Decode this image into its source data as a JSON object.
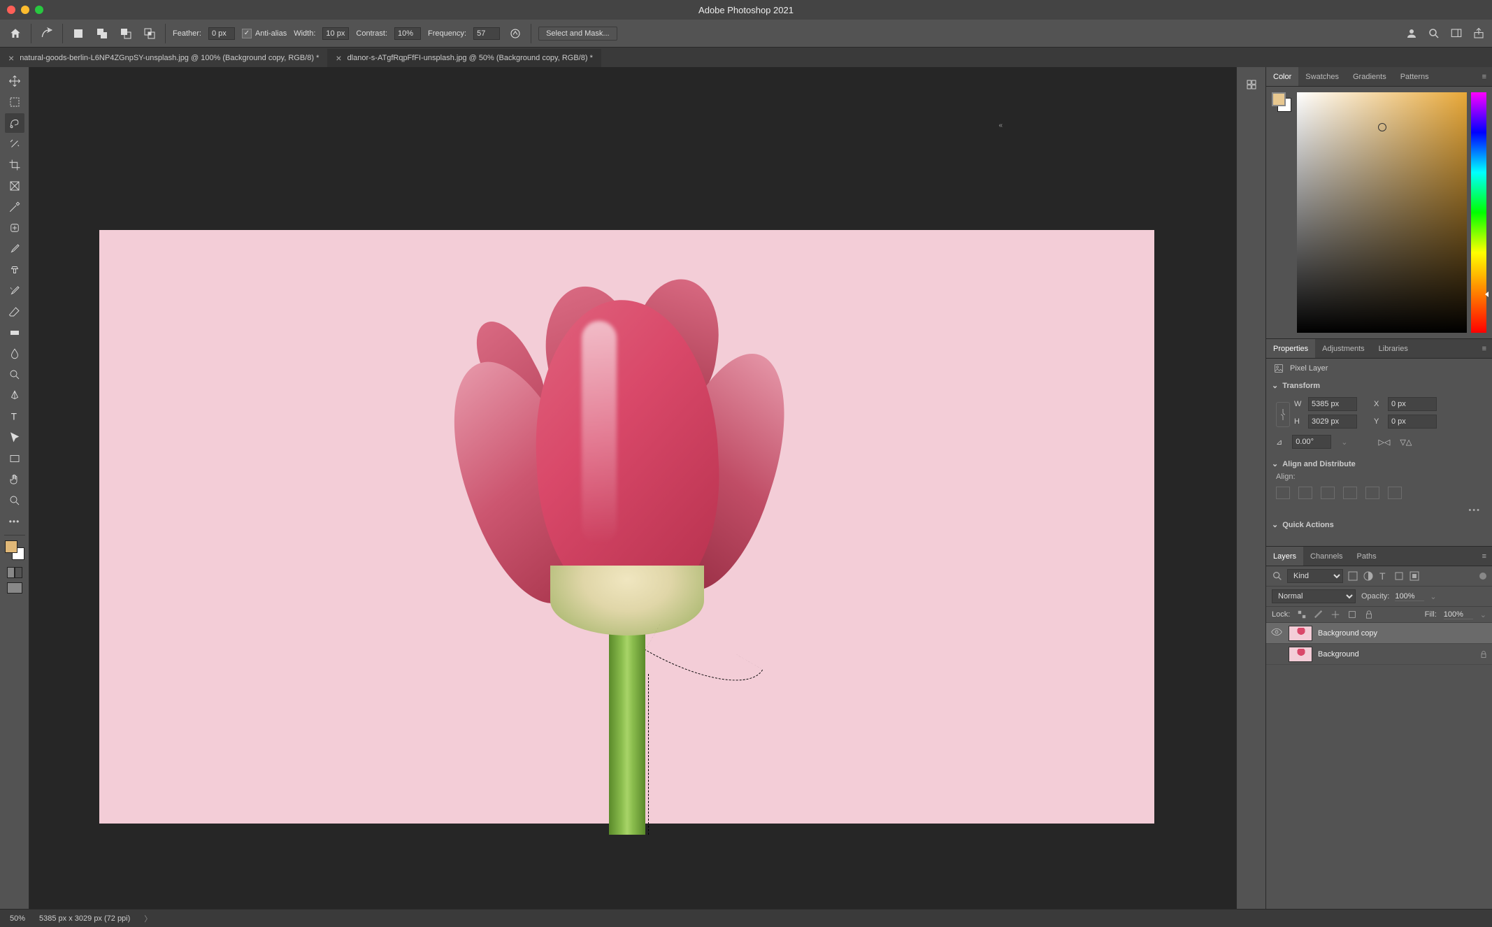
{
  "app": {
    "title": "Adobe Photoshop 2021"
  },
  "options": {
    "feather_label": "Feather:",
    "feather_value": "0 px",
    "antialias_label": "Anti-alias",
    "antialias_checked": true,
    "width_label": "Width:",
    "width_value": "10 px",
    "contrast_label": "Contrast:",
    "contrast_value": "10%",
    "frequency_label": "Frequency:",
    "frequency_value": "57",
    "select_mask_label": "Select and Mask..."
  },
  "tabs": [
    {
      "label": "natural-goods-berlin-L6NP4ZGnpSY-unsplash.jpg @ 100% (Background copy, RGB/8) *",
      "active": false
    },
    {
      "label": "dlanor-s-ATgfRqpFfFI-unsplash.jpg @ 50% (Background copy, RGB/8) *",
      "active": true
    }
  ],
  "color_panel": {
    "tabs": [
      "Color",
      "Swatches",
      "Gradients",
      "Patterns"
    ],
    "active": 0,
    "foreground": "#e8c890",
    "background": "#ffffff"
  },
  "properties_panel": {
    "tabs": [
      "Properties",
      "Adjustments",
      "Libraries"
    ],
    "active": 0,
    "layer_type_label": "Pixel Layer",
    "transform_label": "Transform",
    "w_label": "W",
    "w_value": "5385 px",
    "h_label": "H",
    "h_value": "3029 px",
    "x_label": "X",
    "x_value": "0 px",
    "y_label": "Y",
    "y_value": "0 px",
    "angle_value": "0.00°",
    "align_label": "Align and Distribute",
    "align_sub": "Align:",
    "quick_label": "Quick Actions"
  },
  "layers_panel": {
    "tabs": [
      "Layers",
      "Channels",
      "Paths"
    ],
    "active": 0,
    "kind_label": "Kind",
    "blend_mode": "Normal",
    "opacity_label": "Opacity:",
    "opacity_value": "100%",
    "lock_label": "Lock:",
    "fill_label": "Fill:",
    "fill_value": "100%",
    "layers": [
      {
        "name": "Background copy",
        "visible": true,
        "selected": true,
        "locked": false
      },
      {
        "name": "Background",
        "visible": true,
        "selected": false,
        "locked": true
      }
    ]
  },
  "status": {
    "zoom": "50%",
    "info": "5385 px x 3029 px (72 ppi)"
  },
  "tools": [
    "move",
    "artboard",
    "magnetic-lasso",
    "wand",
    "crop",
    "frame",
    "eyedropper",
    "healing",
    "brush",
    "clone",
    "history-brush",
    "eraser",
    "gradient",
    "blur",
    "dodge",
    "pen",
    "type",
    "path-select",
    "rectangle",
    "hand",
    "zoom"
  ]
}
